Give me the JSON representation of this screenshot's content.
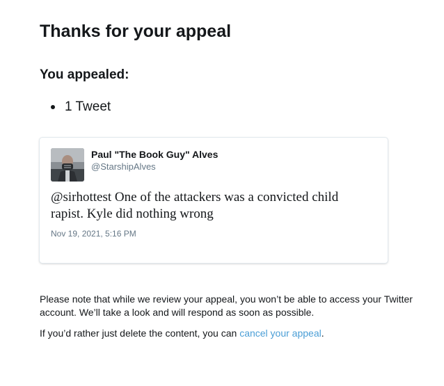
{
  "page": {
    "title": "Thanks for your appeal",
    "section_title": "You appealed:",
    "appealed_items": [
      "1 Tweet"
    ]
  },
  "tweet": {
    "author_name": "Paul \"The Book Guy\" Alves",
    "author_handle": "@StarshipAlves",
    "text": "@sirhottest One of the attackers was a convicted child rapist. Kyle did nothing wrong",
    "timestamp": "Nov 19, 2021, 5:16 PM",
    "avatar_icon": "user-avatar-photo"
  },
  "notes": {
    "review_notice": "Please note that while we review your appeal, you won’t be able to access your Twitter account. We’ll take a look and will respond as soon as possible.",
    "delete_prefix": "If you’d rather just delete the content, you can ",
    "cancel_link_label": "cancel your appeal",
    "delete_suffix": "."
  },
  "colors": {
    "text": "#14171a",
    "secondary_text": "#657786",
    "link": "#4a9ed6",
    "card_border": "#e1e8ed"
  }
}
